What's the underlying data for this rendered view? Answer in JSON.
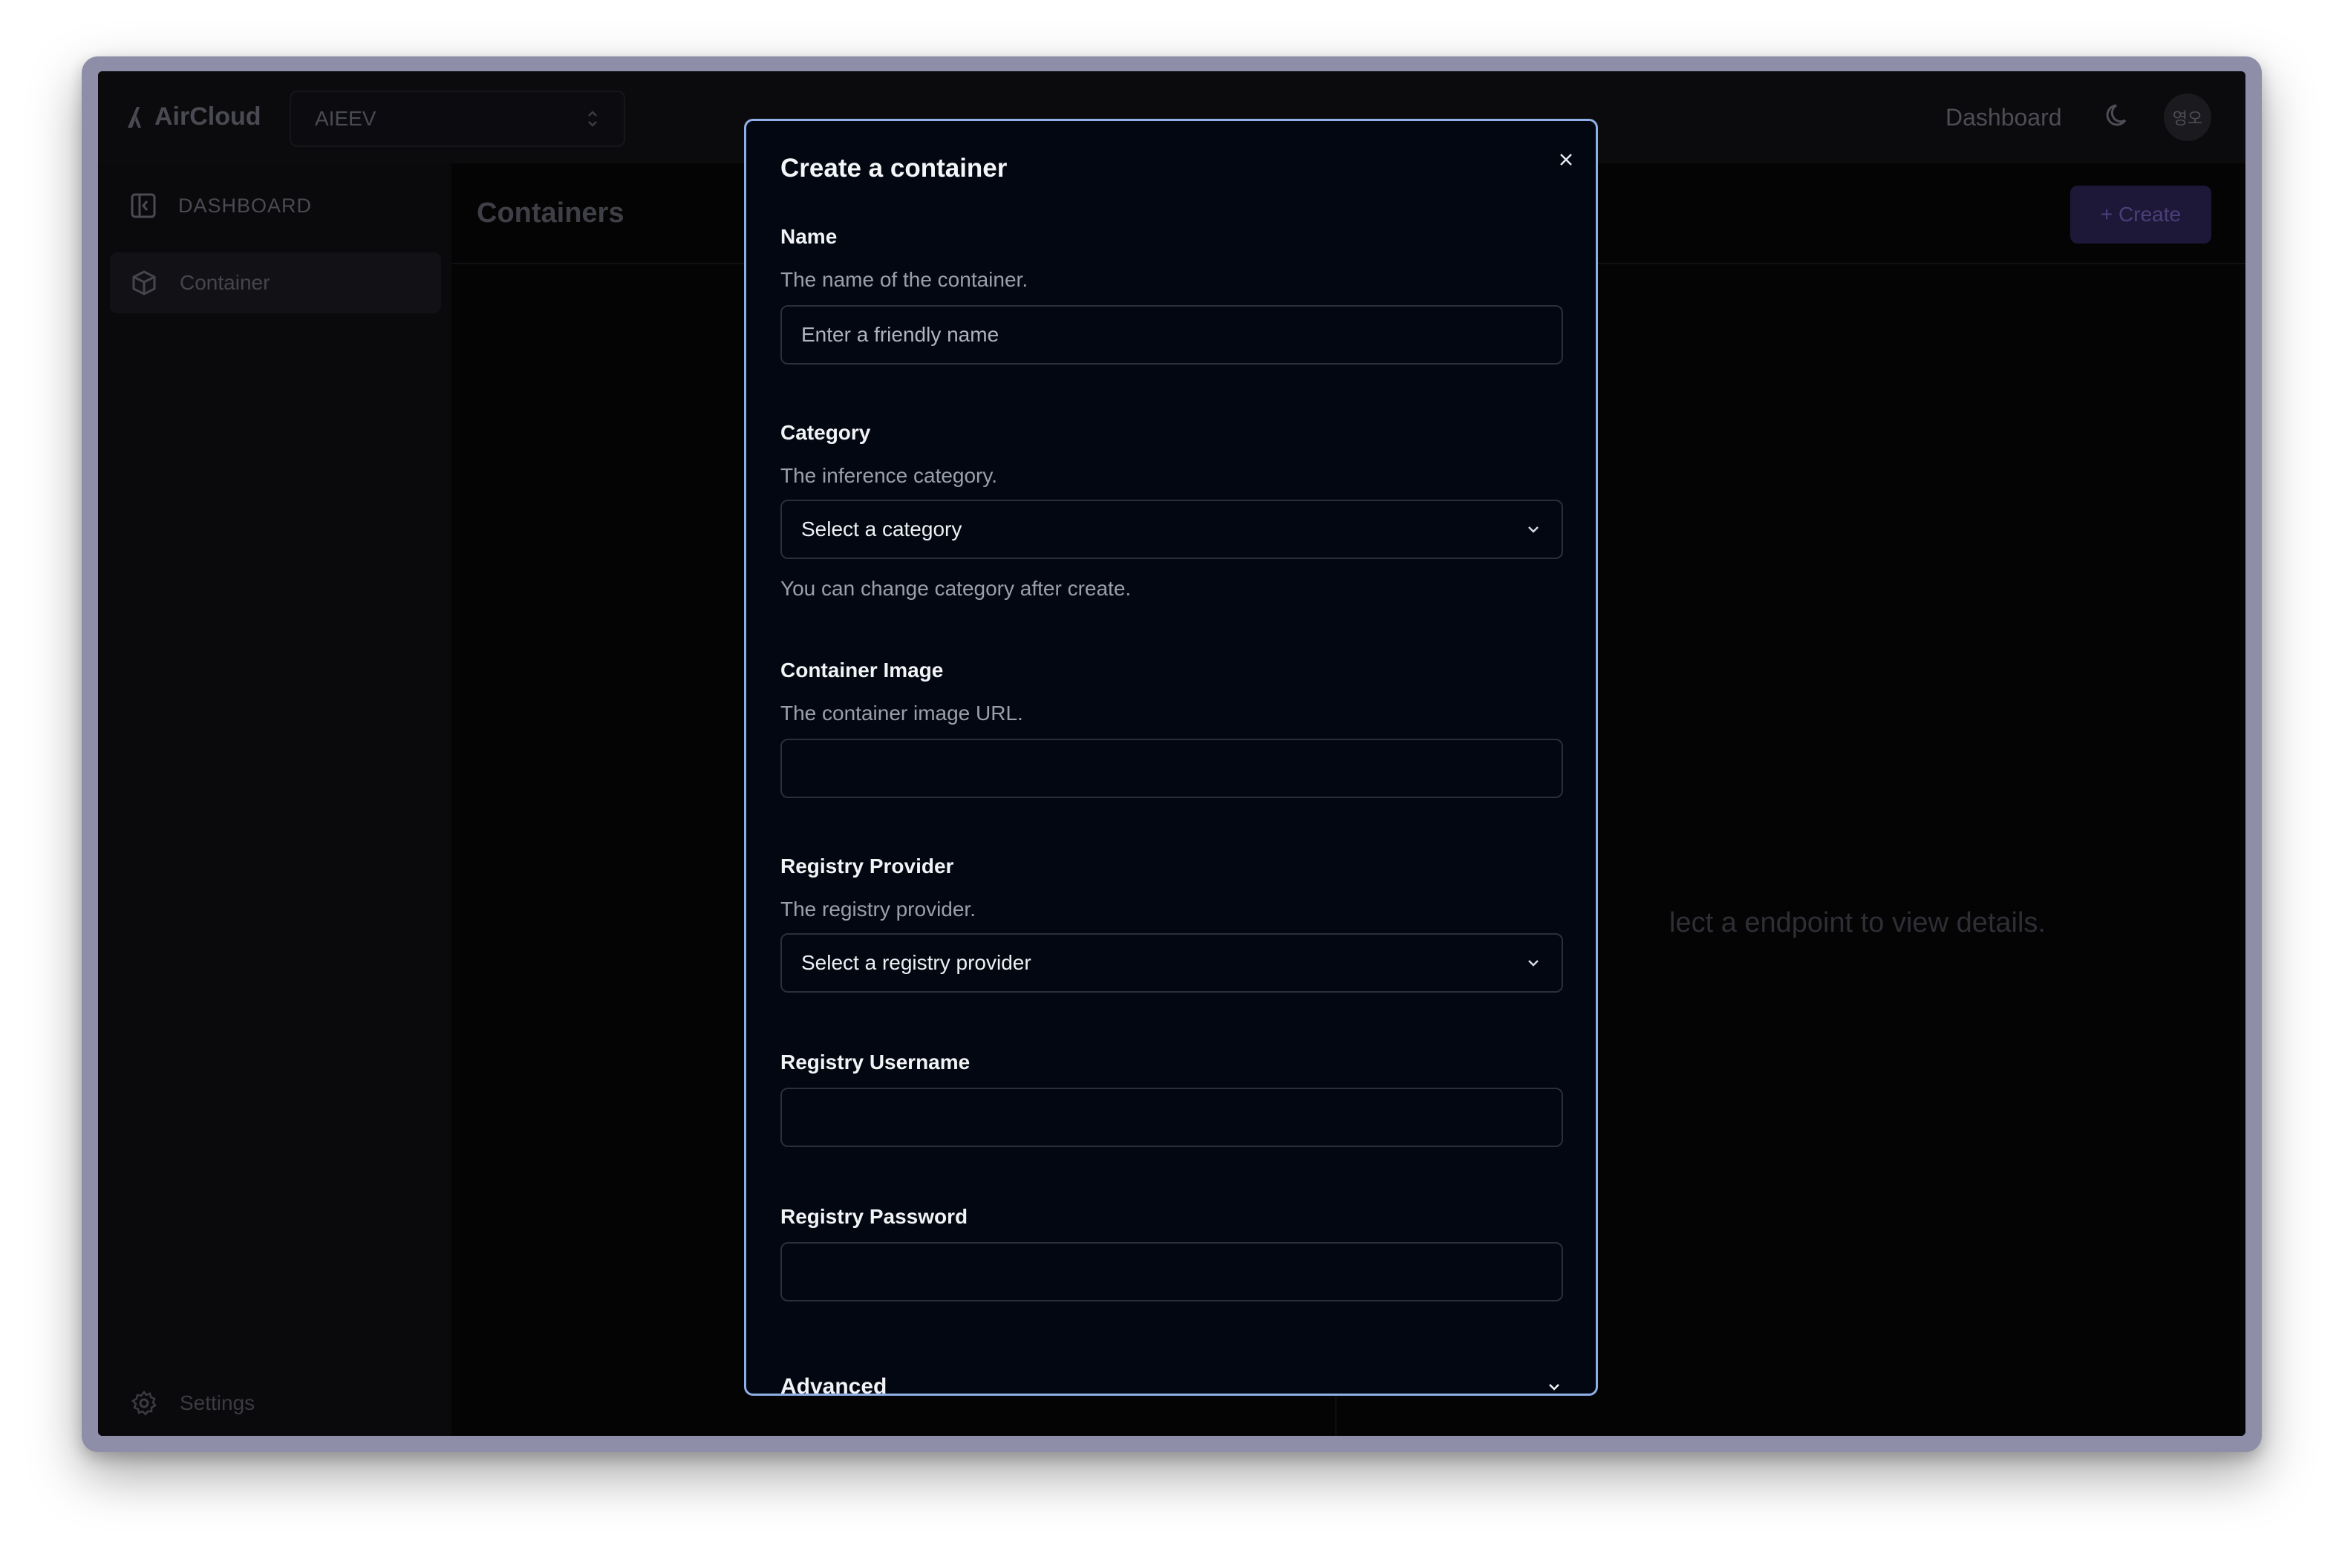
{
  "app": {
    "brand": "AirCloud",
    "workspace": "AIEEV",
    "nav_link": "Dashboard",
    "avatar": "영오"
  },
  "sidebar": {
    "header": "DASHBOARD",
    "items": [
      {
        "label": "Container",
        "icon": "box-icon"
      }
    ],
    "settings": "Settings"
  },
  "main": {
    "title": "Containers",
    "create_label": "+ Create",
    "empty_text": "Select a endpoint to view details.",
    "empty_visible": "lect a endpoint to view details."
  },
  "modal": {
    "title": "Create a container",
    "name": {
      "label": "Name",
      "description": "The name of the container.",
      "placeholder": "Enter a friendly name",
      "value": ""
    },
    "category": {
      "label": "Category",
      "description": "The inference category.",
      "selected": "Select a category",
      "hint": "You can change category after create."
    },
    "image": {
      "label": "Container Image",
      "description": "The container image URL.",
      "value": ""
    },
    "registry_provider": {
      "label": "Registry Provider",
      "description": "The registry provider.",
      "selected": "Select a registry provider"
    },
    "registry_username": {
      "label": "Registry Username",
      "value": ""
    },
    "registry_password": {
      "label": "Registry Password",
      "value": ""
    },
    "advanced": "Advanced"
  },
  "colors": {
    "modal_border": "#8fb0e6",
    "modal_bg": "#030712",
    "accent_button": "#1e1838"
  }
}
